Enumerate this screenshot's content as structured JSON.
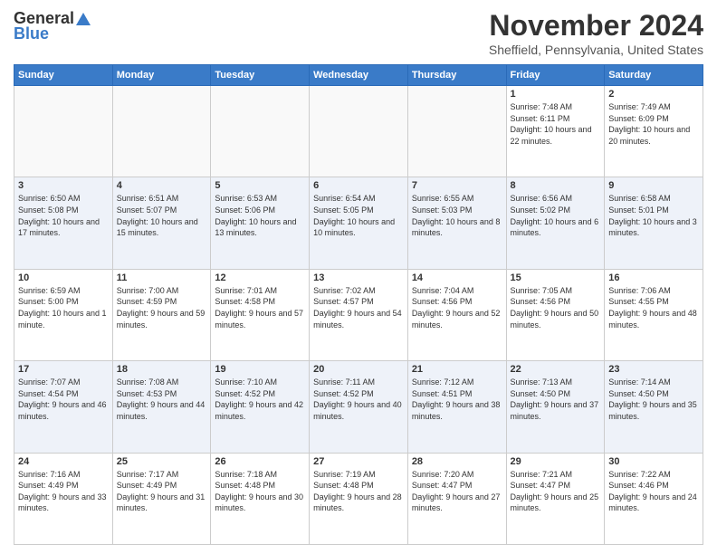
{
  "header": {
    "logo": {
      "general": "General",
      "blue": "Blue"
    },
    "title": "November 2024",
    "location": "Sheffield, Pennsylvania, United States"
  },
  "calendar": {
    "days_of_week": [
      "Sunday",
      "Monday",
      "Tuesday",
      "Wednesday",
      "Thursday",
      "Friday",
      "Saturday"
    ],
    "weeks": [
      [
        {
          "day": "",
          "empty": true
        },
        {
          "day": "",
          "empty": true
        },
        {
          "day": "",
          "empty": true
        },
        {
          "day": "",
          "empty": true
        },
        {
          "day": "",
          "empty": true
        },
        {
          "day": "1",
          "sunrise": "Sunrise: 7:48 AM",
          "sunset": "Sunset: 6:11 PM",
          "daylight": "Daylight: 10 hours and 22 minutes."
        },
        {
          "day": "2",
          "sunrise": "Sunrise: 7:49 AM",
          "sunset": "Sunset: 6:09 PM",
          "daylight": "Daylight: 10 hours and 20 minutes."
        }
      ],
      [
        {
          "day": "3",
          "sunrise": "Sunrise: 6:50 AM",
          "sunset": "Sunset: 5:08 PM",
          "daylight": "Daylight: 10 hours and 17 minutes."
        },
        {
          "day": "4",
          "sunrise": "Sunrise: 6:51 AM",
          "sunset": "Sunset: 5:07 PM",
          "daylight": "Daylight: 10 hours and 15 minutes."
        },
        {
          "day": "5",
          "sunrise": "Sunrise: 6:53 AM",
          "sunset": "Sunset: 5:06 PM",
          "daylight": "Daylight: 10 hours and 13 minutes."
        },
        {
          "day": "6",
          "sunrise": "Sunrise: 6:54 AM",
          "sunset": "Sunset: 5:05 PM",
          "daylight": "Daylight: 10 hours and 10 minutes."
        },
        {
          "day": "7",
          "sunrise": "Sunrise: 6:55 AM",
          "sunset": "Sunset: 5:03 PM",
          "daylight": "Daylight: 10 hours and 8 minutes."
        },
        {
          "day": "8",
          "sunrise": "Sunrise: 6:56 AM",
          "sunset": "Sunset: 5:02 PM",
          "daylight": "Daylight: 10 hours and 6 minutes."
        },
        {
          "day": "9",
          "sunrise": "Sunrise: 6:58 AM",
          "sunset": "Sunset: 5:01 PM",
          "daylight": "Daylight: 10 hours and 3 minutes."
        }
      ],
      [
        {
          "day": "10",
          "sunrise": "Sunrise: 6:59 AM",
          "sunset": "Sunset: 5:00 PM",
          "daylight": "Daylight: 10 hours and 1 minute."
        },
        {
          "day": "11",
          "sunrise": "Sunrise: 7:00 AM",
          "sunset": "Sunset: 4:59 PM",
          "daylight": "Daylight: 9 hours and 59 minutes."
        },
        {
          "day": "12",
          "sunrise": "Sunrise: 7:01 AM",
          "sunset": "Sunset: 4:58 PM",
          "daylight": "Daylight: 9 hours and 57 minutes."
        },
        {
          "day": "13",
          "sunrise": "Sunrise: 7:02 AM",
          "sunset": "Sunset: 4:57 PM",
          "daylight": "Daylight: 9 hours and 54 minutes."
        },
        {
          "day": "14",
          "sunrise": "Sunrise: 7:04 AM",
          "sunset": "Sunset: 4:56 PM",
          "daylight": "Daylight: 9 hours and 52 minutes."
        },
        {
          "day": "15",
          "sunrise": "Sunrise: 7:05 AM",
          "sunset": "Sunset: 4:56 PM",
          "daylight": "Daylight: 9 hours and 50 minutes."
        },
        {
          "day": "16",
          "sunrise": "Sunrise: 7:06 AM",
          "sunset": "Sunset: 4:55 PM",
          "daylight": "Daylight: 9 hours and 48 minutes."
        }
      ],
      [
        {
          "day": "17",
          "sunrise": "Sunrise: 7:07 AM",
          "sunset": "Sunset: 4:54 PM",
          "daylight": "Daylight: 9 hours and 46 minutes."
        },
        {
          "day": "18",
          "sunrise": "Sunrise: 7:08 AM",
          "sunset": "Sunset: 4:53 PM",
          "daylight": "Daylight: 9 hours and 44 minutes."
        },
        {
          "day": "19",
          "sunrise": "Sunrise: 7:10 AM",
          "sunset": "Sunset: 4:52 PM",
          "daylight": "Daylight: 9 hours and 42 minutes."
        },
        {
          "day": "20",
          "sunrise": "Sunrise: 7:11 AM",
          "sunset": "Sunset: 4:52 PM",
          "daylight": "Daylight: 9 hours and 40 minutes."
        },
        {
          "day": "21",
          "sunrise": "Sunrise: 7:12 AM",
          "sunset": "Sunset: 4:51 PM",
          "daylight": "Daylight: 9 hours and 38 minutes."
        },
        {
          "day": "22",
          "sunrise": "Sunrise: 7:13 AM",
          "sunset": "Sunset: 4:50 PM",
          "daylight": "Daylight: 9 hours and 37 minutes."
        },
        {
          "day": "23",
          "sunrise": "Sunrise: 7:14 AM",
          "sunset": "Sunset: 4:50 PM",
          "daylight": "Daylight: 9 hours and 35 minutes."
        }
      ],
      [
        {
          "day": "24",
          "sunrise": "Sunrise: 7:16 AM",
          "sunset": "Sunset: 4:49 PM",
          "daylight": "Daylight: 9 hours and 33 minutes."
        },
        {
          "day": "25",
          "sunrise": "Sunrise: 7:17 AM",
          "sunset": "Sunset: 4:49 PM",
          "daylight": "Daylight: 9 hours and 31 minutes."
        },
        {
          "day": "26",
          "sunrise": "Sunrise: 7:18 AM",
          "sunset": "Sunset: 4:48 PM",
          "daylight": "Daylight: 9 hours and 30 minutes."
        },
        {
          "day": "27",
          "sunrise": "Sunrise: 7:19 AM",
          "sunset": "Sunset: 4:48 PM",
          "daylight": "Daylight: 9 hours and 28 minutes."
        },
        {
          "day": "28",
          "sunrise": "Sunrise: 7:20 AM",
          "sunset": "Sunset: 4:47 PM",
          "daylight": "Daylight: 9 hours and 27 minutes."
        },
        {
          "day": "29",
          "sunrise": "Sunrise: 7:21 AM",
          "sunset": "Sunset: 4:47 PM",
          "daylight": "Daylight: 9 hours and 25 minutes."
        },
        {
          "day": "30",
          "sunrise": "Sunrise: 7:22 AM",
          "sunset": "Sunset: 4:46 PM",
          "daylight": "Daylight: 9 hours and 24 minutes."
        }
      ]
    ]
  }
}
